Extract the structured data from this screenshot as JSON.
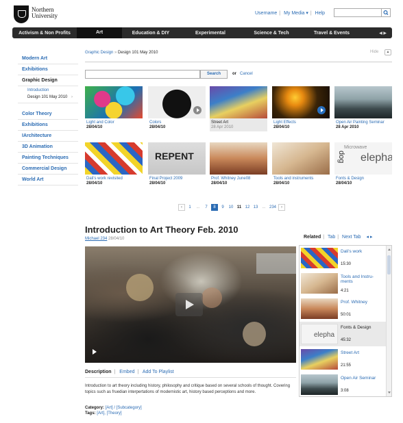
{
  "header": {
    "logo_line1": "Northern",
    "logo_line2": "University",
    "links": [
      "Username",
      "My Media ▾",
      "Help"
    ]
  },
  "nav": {
    "items": [
      "Activism & Non Profits",
      "Art",
      "Education & DIY",
      "Experimental",
      "Science & Tech",
      "Travel & Events"
    ],
    "active": "Art",
    "arrows": "◀ ▶"
  },
  "sidebar": {
    "group1": [
      "Modern Art",
      "Exhibitions",
      "Graphic Design"
    ],
    "sub": [
      "Introduction",
      "Design 101 May 2010"
    ],
    "group2": [
      "Color Theory",
      "Exhibitions",
      "IArchitecture",
      "3D Animation",
      "Painting Techniques",
      "Commercial Design",
      "World Art"
    ]
  },
  "breadcrumb": {
    "parent": "Graphic Design",
    "sep": "»",
    "current": "Design 101 May 2010"
  },
  "hide_label": "Hide",
  "search": {
    "button": "Search",
    "or": "or",
    "cancel": "Cancel"
  },
  "thumbs": [
    {
      "title": "Light and Color",
      "date": "28/04/10"
    },
    {
      "title": "Colors",
      "date": "28/04/10"
    },
    {
      "title": "Street Art",
      "date": "28 Apr 2010"
    },
    {
      "title": "Light Effects",
      "date": "28/04/10"
    },
    {
      "title": "Open Air Painting Seminar",
      "date": "28 Apr 2010"
    },
    {
      "title": "Dali's work revisited",
      "date": "28/04/10"
    },
    {
      "title": "Final Project 2009",
      "date": "28/04/10"
    },
    {
      "title": "Prof. Whitney June08",
      "date": "28/04/10"
    },
    {
      "title": "Tools and instruments",
      "date": "28/04/10"
    },
    {
      "title": "Fonts & Design",
      "date": "28/04/10"
    }
  ],
  "pager": [
    "‹",
    "1",
    "...",
    "7",
    "8",
    "9",
    "10",
    "11",
    "12",
    "13",
    "...",
    "234",
    "›"
  ],
  "video": {
    "title": "Introduction to Art Theory Feb. 2010",
    "user": "Michael 234",
    "date": "28/04/10",
    "tabs": [
      "Description",
      "Embed",
      "Add To Playlist"
    ],
    "description": "Introduction to art theory including history, philosophy and critique based on several schools of thought. Covering topics such as fruedian interpertations of modernistic art, history based perceptions and more.",
    "category_label": "Category:",
    "category": "[Art] / [Subcategory]",
    "tags_label": "Tags:",
    "tags": "[Art], [Theory]"
  },
  "related": {
    "tabs": [
      "Related",
      "Tab",
      "Next Tab"
    ],
    "arrows": "◂ ▸",
    "items": [
      {
        "title": "Dali's work",
        "dur": "15:30"
      },
      {
        "title": "Tools and Instru-ments",
        "dur": "4:21"
      },
      {
        "title": "Prof. Whitney",
        "dur": "50:01"
      },
      {
        "title": "Fonts & Design",
        "dur": "45:32"
      },
      {
        "title": "Street Art",
        "dur": "21:55"
      },
      {
        "title": "Open Air Seminar",
        "dur": "3:08"
      }
    ]
  }
}
